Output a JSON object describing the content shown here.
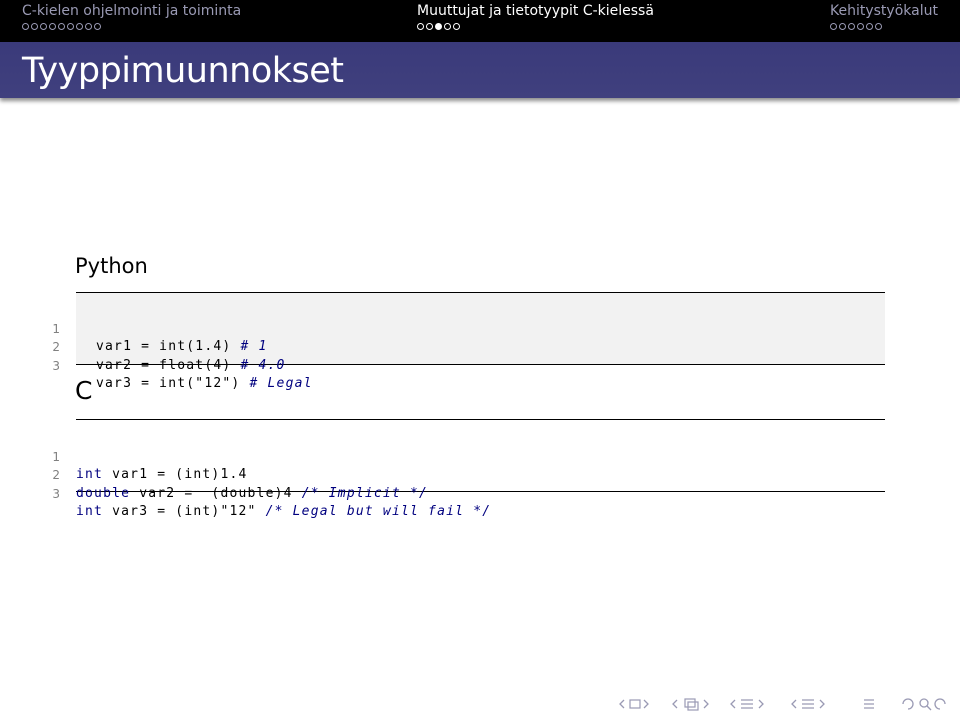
{
  "header": {
    "sections": [
      {
        "title": "C-kielen ohjelmointi ja toiminta",
        "dots": 9,
        "filled": -1,
        "active": false
      },
      {
        "title": "Muuttujat ja tietotyypit C-kielessä",
        "dots": 5,
        "filled": 2,
        "active": true
      },
      {
        "title": "Kehitystyökalut",
        "dots": 6,
        "filled": -1,
        "active": false
      }
    ]
  },
  "frame": {
    "title": "Tyyppimuunnokset"
  },
  "python": {
    "label": "Python",
    "lines": [
      {
        "no": "1",
        "code": "var1 = int(1.4)",
        "comment": "# 1"
      },
      {
        "no": "2",
        "code": "var2 = float(4)",
        "comment": "# 4.0"
      },
      {
        "no": "3",
        "code": "var3 = int(\"12\")",
        "comment": "# Legal"
      }
    ]
  },
  "c": {
    "label": "C",
    "lines": [
      {
        "no": "1",
        "kw": "int",
        "code": " var1 = (int)1.4",
        "comment": ""
      },
      {
        "no": "2",
        "kw": "double",
        "code": " var2 =  (double)4 ",
        "comment": "/* Implicit */"
      },
      {
        "no": "3",
        "kw": "int",
        "code": " var3 = (int)\"12\" ",
        "comment": "/* Legal but will fail */"
      }
    ]
  },
  "nav": {
    "icons": [
      "nav-left-arrow-icon",
      "nav-frame-icon",
      "nav-subsection-icon",
      "nav-section-icon",
      "nav-align-icon",
      "nav-search-icon"
    ]
  }
}
